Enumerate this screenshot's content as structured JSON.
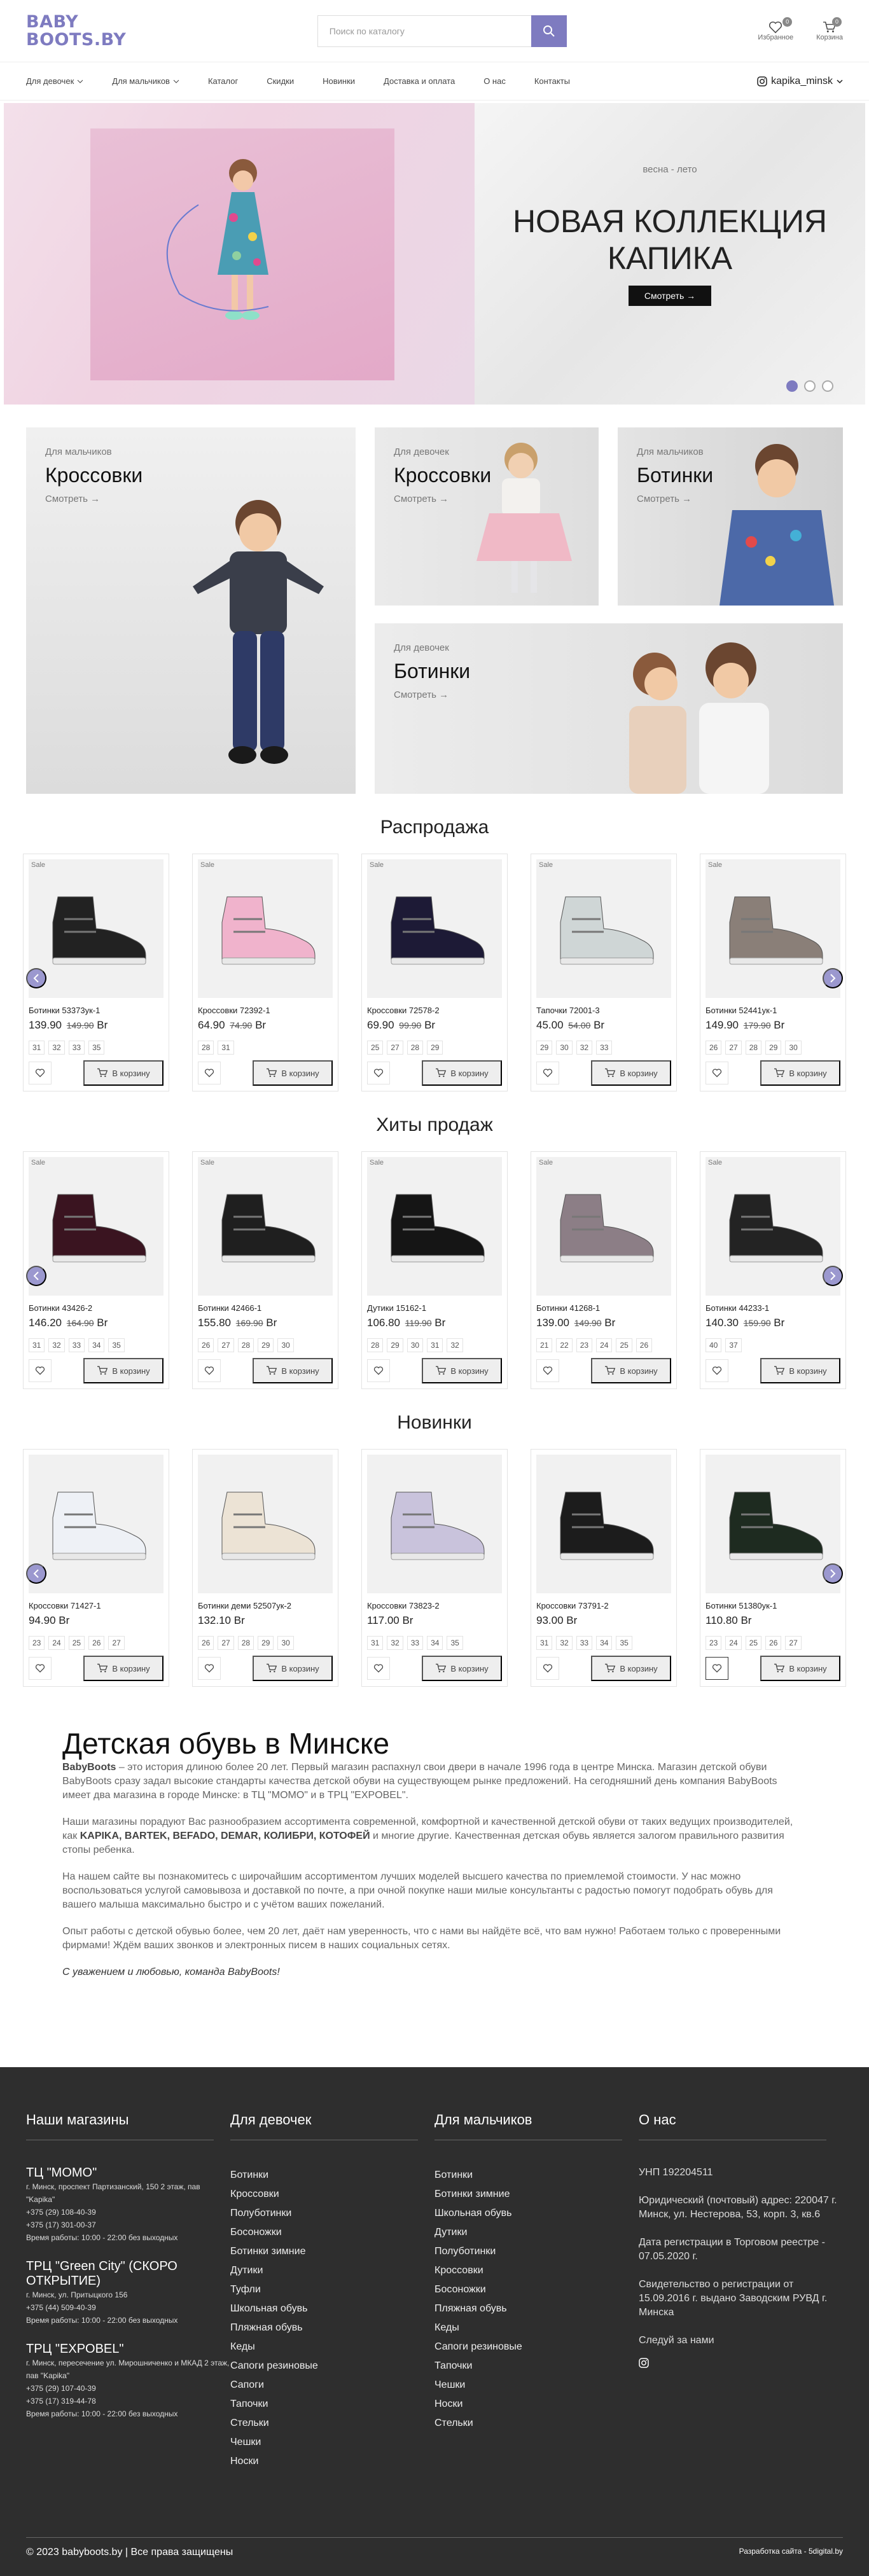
{
  "header": {
    "logo_line1": "BABY",
    "logo_line2": "BOOTS.BY",
    "search_placeholder": "Поиск по каталогу",
    "favorites_label": "Избранное",
    "favorites_count": "0",
    "cart_label": "Корзина",
    "cart_count": "0"
  },
  "nav": {
    "items": [
      "Для девочек",
      "Для мальчиков",
      "Каталог",
      "Скидки",
      "Новинки",
      "Доставка и оплата",
      "О нас",
      "Контакты"
    ],
    "instagram": "kapika_minsk"
  },
  "hero": {
    "subtitle": "весна - лето",
    "title": "НОВАЯ КОЛЛЕКЦИЯ КАПИКА",
    "button": "Смотреть",
    "slides": 3,
    "active_slide": 1
  },
  "categories": [
    {
      "kicker": "Для мальчиков",
      "title": "Кроссовки",
      "more": "Смотреть"
    },
    {
      "kicker": "Для девочек",
      "title": "Кроссовки",
      "more": "Смотреть"
    },
    {
      "kicker": "Для мальчиков",
      "title": "Ботинки",
      "more": "Смотреть"
    },
    {
      "kicker": "Для девочек",
      "title": "Ботинки",
      "more": "Смотреть"
    }
  ],
  "sections": [
    {
      "title": "Распродажа",
      "products": [
        {
          "sale": "Sale",
          "name": "Ботинки 53373ук-1",
          "price": "139.90",
          "old": "149.90",
          "cur": "Br",
          "sizes": [
            "31",
            "32",
            "33",
            "35"
          ],
          "shoe_color": "#222"
        },
        {
          "sale": "Sale",
          "name": "Кроссовки 72392-1",
          "price": "64.90",
          "old": "74.90",
          "cur": "Br",
          "sizes": [
            "28",
            "31"
          ],
          "shoe_color": "#f0b3cc"
        },
        {
          "sale": "Sale",
          "name": "Кроссовки 72578-2",
          "price": "69.90",
          "old": "99.90",
          "cur": "Br",
          "sizes": [
            "25",
            "27",
            "28",
            "29"
          ],
          "shoe_color": "#1d1a36"
        },
        {
          "sale": "Sale",
          "name": "Тапочки 72001-3",
          "price": "45.00",
          "old": "54.00",
          "cur": "Br",
          "sizes": [
            "29",
            "30",
            "32",
            "33"
          ],
          "shoe_color": "#cfd6d6"
        },
        {
          "sale": "Sale",
          "name": "Ботинки 52441ук-1",
          "price": "149.90",
          "old": "179.90",
          "cur": "Br",
          "sizes": [
            "26",
            "27",
            "28",
            "29",
            "30"
          ],
          "shoe_color": "#8a7f78"
        }
      ]
    },
    {
      "title": "Хиты продаж",
      "products": [
        {
          "sale": "Sale",
          "name": "Ботинки 43426-2",
          "price": "146.20",
          "old": "164.90",
          "cur": "Br",
          "sizes": [
            "31",
            "32",
            "33",
            "34",
            "35"
          ],
          "shoe_color": "#3a1420"
        },
        {
          "sale": "Sale",
          "name": "Ботинки 42466-1",
          "price": "155.80",
          "old": "169.90",
          "cur": "Br",
          "sizes": [
            "26",
            "27",
            "28",
            "29",
            "30"
          ],
          "shoe_color": "#1f1f1f"
        },
        {
          "sale": "Sale",
          "name": "Дутики 15162-1",
          "price": "106.80",
          "old": "119.90",
          "cur": "Br",
          "sizes": [
            "28",
            "29",
            "30",
            "31",
            "32"
          ],
          "shoe_color": "#151515"
        },
        {
          "sale": "Sale",
          "name": "Ботинки 41268-1",
          "price": "139.00",
          "old": "149.90",
          "cur": "Br",
          "sizes": [
            "21",
            "22",
            "23",
            "24",
            "25",
            "26"
          ],
          "shoe_color": "#8c7e86"
        },
        {
          "sale": "Sale",
          "name": "Ботинки 44233-1",
          "price": "140.30",
          "old": "159.90",
          "cur": "Br",
          "sizes": [
            "40",
            "37"
          ],
          "shoe_color": "#232323"
        }
      ]
    },
    {
      "title": "Новинки",
      "products": [
        {
          "sale": "",
          "name": "Кроссовки 71427-1",
          "price": "94.90",
          "old": "",
          "cur": "Br",
          "sizes": [
            "23",
            "24",
            "25",
            "26",
            "27"
          ],
          "shoe_color": "#eef1f6"
        },
        {
          "sale": "",
          "name": "Ботинки деми 52507ук-2",
          "price": "132.10",
          "old": "",
          "cur": "Br",
          "sizes": [
            "26",
            "27",
            "28",
            "29",
            "30"
          ],
          "shoe_color": "#ece3d5"
        },
        {
          "sale": "",
          "name": "Кроссовки 73823-2",
          "price": "117.00",
          "old": "",
          "cur": "Br",
          "sizes": [
            "31",
            "32",
            "33",
            "34",
            "35"
          ],
          "shoe_color": "#c9c3dc"
        },
        {
          "sale": "",
          "name": "Кроссовки 73791-2",
          "price": "93.00",
          "old": "",
          "cur": "Br",
          "sizes": [
            "31",
            "32",
            "33",
            "34",
            "35"
          ],
          "shoe_color": "#1c1c1c"
        },
        {
          "sale": "",
          "name": "Ботинки 51380ук-1",
          "price": "110.80",
          "old": "",
          "cur": "Br",
          "sizes": [
            "23",
            "24",
            "25",
            "26",
            "27"
          ],
          "shoe_color": "#1e2b20"
        }
      ]
    }
  ],
  "cart_label": "В корзину",
  "about": {
    "title": "Детская обувь в Минске",
    "p1_brand": "BabyBoots",
    "p1": " – это история длиною более 20 лет. Первый магазин распахнул свои двери в начале 1996 года в центре Минска. Магазин детской обуви BabyBoots сразу задал высокие стандарты качества детской обуви на существующем рынке предложений. На сегодняшний день компания BabyBoots имеет два магазина в городе Минске: в ТЦ \"МОМО\" и в ТРЦ \"EXPOBEL\".",
    "p2_a": "Наши магазины порадуют Вас разнообразием ассортимента современной, комфортной и качественной детской обуви от таких ведущих производителей, как ",
    "p2_brands": "KAPIKA, BARTEK, BEFADO, DEMAR, КОЛИБРИ, КОТОФЕЙ",
    "p2_b": " и многие другие. Качественная детская обувь является залогом правильного развития стопы ребенка.",
    "p3": "На нашем сайте вы познакомитесь с широчайшим ассортиментом лучших моделей высшего качества по приемлемой стоимости. У нас можно воспользоваться услугой самовывоза и доставкой по почте, а при очной покупке наши милые консультанты с радостью помогут подобрать обувь для вашего малыша максимально быстро и с учётом ваших пожеланий.",
    "p4": "Опыт работы с детской обувью более, чем 20 лет, даёт нам уверенность, что с нами вы найдёте всё, что вам нужно! Работаем только с проверенными фирмами! Ждём ваших звонков и электронных писем в наших социальных сетях.",
    "sign": "С уважением и любовью, команда BabyBoots!"
  },
  "footer": {
    "stores_title": "Наши магазины",
    "stores": [
      {
        "name": "ТЦ \"МОМО\"",
        "lines": [
          "г. Минск, проспект Партизанский, 150 2 этаж, пав \"Kapika\"",
          "+375 (29) 108-40-39",
          "+375 (17) 301-00-37",
          "Время работы: 10:00 - 22:00 без выходных"
        ]
      },
      {
        "name": "ТРЦ \"Green City\" (СКОРО ОТКРЫТИЕ)",
        "lines": [
          "г. Минск, ул. Притыцкого 156",
          "+375 (44) 509-40-39",
          "Время работы: 10:00 - 22:00 без выходных"
        ]
      },
      {
        "name": "ТРЦ \"EXPOBEL\"",
        "lines": [
          "г. Минск, пересечение ул. Мирошниченко и МКАД 2 этаж, пав \"Kapika\"",
          "+375 (29) 107-40-39",
          "+375 (17) 319-44-78",
          "Время работы: 10:00 - 22:00 без выходных"
        ]
      }
    ],
    "girls_title": "Для девочек",
    "girls": [
      "Ботинки",
      "Кроссовки",
      "Полуботинки",
      "Босоножки",
      "Ботинки зимние",
      "Дутики",
      "Туфли",
      "Школьная обувь",
      "Пляжная обувь",
      "Кеды",
      "Сапоги резиновые",
      "Сапоги",
      "Тапочки",
      "Стельки",
      "Чешки",
      "Носки"
    ],
    "boys_title": "Для мальчиков",
    "boys": [
      "Ботинки",
      "Ботинки зимние",
      "Школьная обувь",
      "Дутики",
      "Полуботинки",
      "Кроссовки",
      "Босоножки",
      "Пляжная обувь",
      "Кеды",
      "Сапоги резиновые",
      "Тапочки",
      "Чешки",
      "Носки",
      "Стельки"
    ],
    "about_title": "О нас",
    "about_lines": [
      "УНП 192204511",
      "Юридический (почтовый) адрес: 220047 г. Минск, ул. Нестерова, 53, корп. 3, кв.6",
      "Дата регистрации в Торговом реестре - 07.05.2020 г.",
      "Свидетельство о регистрации от 15.09.2016 г. выдано Заводским РУВД г. Минска"
    ],
    "follow": "Следуй за нами",
    "copyright": "© 2023 babyboots.by | Все права защищены",
    "developer": "Разработка сайта - 5digital.by"
  },
  "colors": {
    "accent": "#7e7bc0",
    "footer_bg": "#2e2e2e"
  }
}
